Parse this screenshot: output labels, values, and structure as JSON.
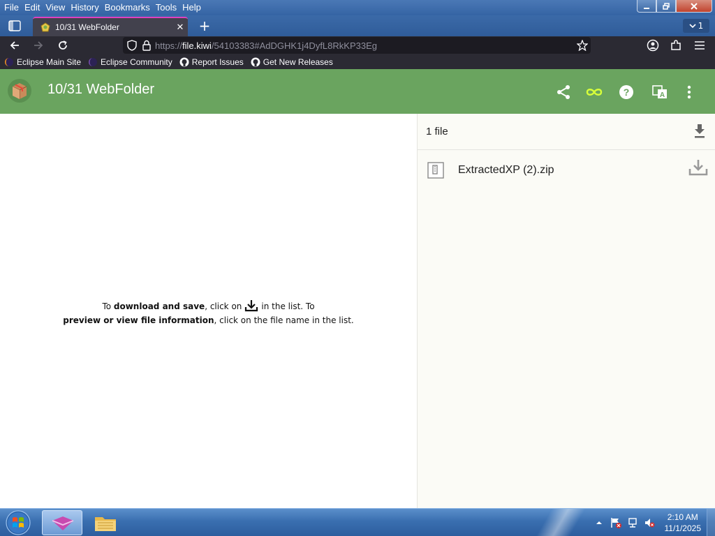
{
  "menubar": {
    "items": [
      {
        "label": "File"
      },
      {
        "label": "Edit"
      },
      {
        "label": "View"
      },
      {
        "label": "History"
      },
      {
        "label": "Bookmarks"
      },
      {
        "label": "Tools"
      },
      {
        "label": "Help"
      }
    ]
  },
  "tabs": {
    "active_title": "10/31 WebFolder",
    "close_glyph": "✕",
    "new_tab_glyph": "+",
    "tab_count": "1"
  },
  "navbar": {
    "url_scheme": "https://",
    "url_domain": "file.kiwi",
    "url_path": "/54103383#AdDGHK1j4DyfL8RkKP33Eg"
  },
  "bookmarks": [
    {
      "label": "Eclipse Main Site",
      "icon": "eclipse-icon"
    },
    {
      "label": "Eclipse Community",
      "icon": "eclipse-icon"
    },
    {
      "label": "Report Issues",
      "icon": "github-icon"
    },
    {
      "label": "Get New Releases",
      "icon": "github-icon"
    }
  ],
  "app": {
    "title": "10/31 WebFolder",
    "header_color": "#6aa45f",
    "infinity_color": "#d8ff3a"
  },
  "instructions": {
    "part1": "To ",
    "bold1": "download and save",
    "part2": ", click on",
    "part3": "in the list. To",
    "bold2": "preview or view file information",
    "part4": ", click on the file name in the list."
  },
  "files": {
    "count_label": "1 file",
    "items": [
      {
        "name": "ExtractedXP (2).zip"
      }
    ]
  },
  "taskbar": {
    "time": "2:10 AM",
    "date": "11/1/2025"
  }
}
